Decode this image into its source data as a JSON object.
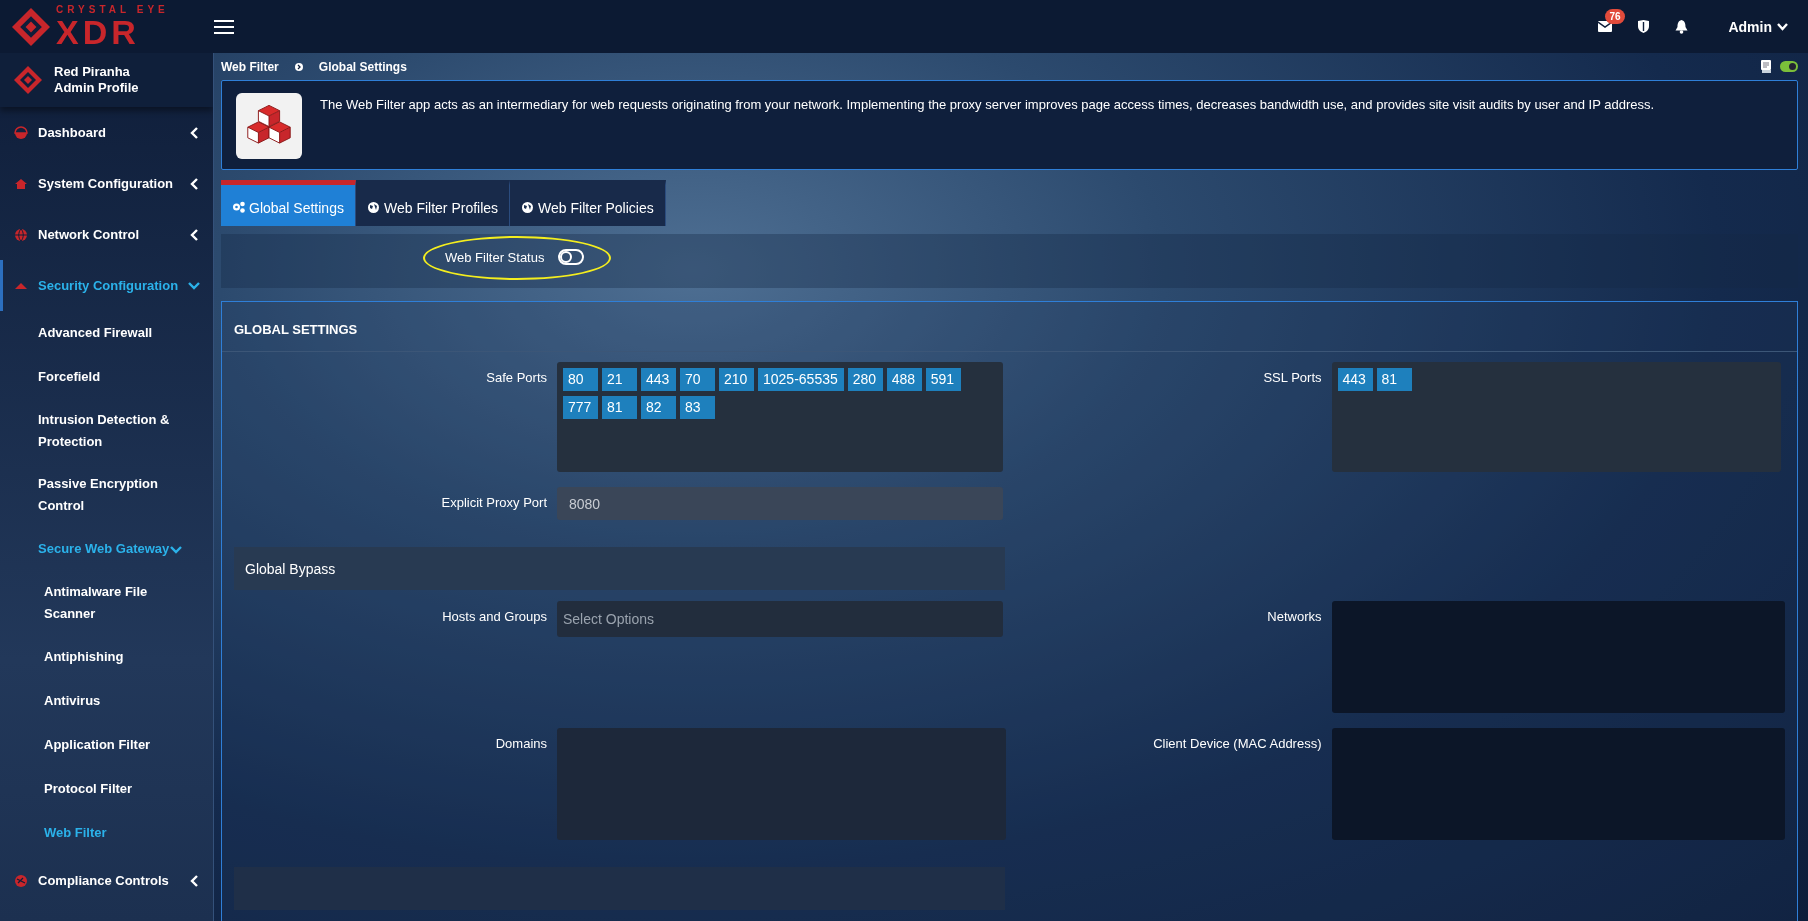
{
  "header": {
    "brand_top": "CRYSTAL EYE",
    "brand_main": "XDR",
    "mail_badge": "76",
    "user": "Admin"
  },
  "profile": {
    "name": "Red Piranha",
    "role": "Admin Profile"
  },
  "sidebar": {
    "items": [
      {
        "label": "Dashboard",
        "expanded": false,
        "selected": false
      },
      {
        "label": "System Configuration",
        "expanded": false,
        "selected": false
      },
      {
        "label": "Network Control",
        "expanded": false,
        "selected": false
      },
      {
        "label": "Security Configuration",
        "expanded": true,
        "selected": true,
        "children": [
          {
            "label": "Advanced Firewall",
            "selected": false
          },
          {
            "label": "Forcefield",
            "selected": false
          },
          {
            "label": "Intrusion Detection & Protection",
            "selected": false
          },
          {
            "label": "Passive Encryption Control",
            "selected": false
          },
          {
            "label": "Secure Web Gateway",
            "expanded": true,
            "selected": true,
            "children": [
              {
                "label": "Antimalware File Scanner",
                "selected": false
              },
              {
                "label": "Antiphishing",
                "selected": false
              },
              {
                "label": "Antivirus",
                "selected": false
              },
              {
                "label": "Application Filter",
                "selected": false
              },
              {
                "label": "Protocol Filter",
                "selected": false
              },
              {
                "label": "Web Filter",
                "selected": true
              }
            ]
          }
        ]
      },
      {
        "label": "Compliance Controls",
        "expanded": false,
        "selected": false
      }
    ]
  },
  "breadcrumb": [
    "Web Filter",
    "Global Settings"
  ],
  "page_toggle": {
    "on": true
  },
  "info": {
    "text": "The Web Filter app acts as an intermediary for web requests originating from your network. Implementing the proxy server improves page access times, decreases bandwidth use, and provides site visit audits by user and IP address."
  },
  "tabs": [
    {
      "label": "Global Settings",
      "selected": true
    },
    {
      "label": "Web Filter Profiles",
      "selected": false
    },
    {
      "label": "Web Filter Policies",
      "selected": false
    }
  ],
  "status": {
    "label": "Web Filter Status",
    "on": false
  },
  "global_settings": {
    "title": "GLOBAL SETTINGS",
    "safe_ports": {
      "label": "Safe Ports",
      "tags": [
        "80",
        "21",
        "443",
        "70",
        "210",
        "1025-65535",
        "280",
        "488",
        "591",
        "777",
        "81",
        "82",
        "83"
      ]
    },
    "ssl_ports": {
      "label": "SSL Ports",
      "tags": [
        "443",
        "81"
      ]
    },
    "explicit_proxy_port": {
      "label": "Explicit Proxy Port",
      "value": "8080"
    },
    "global_bypass": {
      "title": "Global Bypass",
      "hosts_and_groups": {
        "label": "Hosts and Groups",
        "placeholder": "Select Options"
      },
      "networks": {
        "label": "Networks"
      },
      "domains": {
        "label": "Domains"
      },
      "client_device": {
        "label": "Client Device (MAC Address)"
      }
    }
  }
}
